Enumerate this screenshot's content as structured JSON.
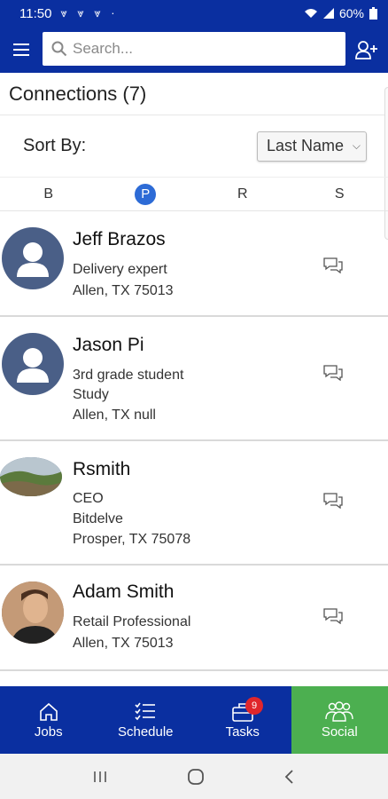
{
  "status_bar": {
    "time": "11:50",
    "notification_icons": "⩔ ⩔ ⩔ ·",
    "battery": "60%"
  },
  "app_bar": {
    "search_placeholder": "Search..."
  },
  "header": {
    "title": "Connections (7)"
  },
  "sort": {
    "label": "Sort By:",
    "selected": "Last Name"
  },
  "letter_index": [
    "B",
    "P",
    "R",
    "S"
  ],
  "active_letter": "P",
  "connections": [
    {
      "name": "Jeff Brazos",
      "line1": "Delivery expert",
      "line2": "Allen, TX 75013",
      "line3": ""
    },
    {
      "name": "Jason Pi",
      "line1": "3rd grade student",
      "line2": "Study",
      "line3": "Allen, TX null"
    },
    {
      "name": "Rsmith",
      "line1": "CEO",
      "line2": "Bitdelve",
      "line3": "Prosper, TX 75078"
    },
    {
      "name": "Adam Smith",
      "line1": "Retail Professional",
      "line2": "Allen, TX 75013",
      "line3": ""
    }
  ],
  "tabs": [
    {
      "label": "Jobs",
      "icon": "home-icon"
    },
    {
      "label": "Schedule",
      "icon": "checklist-icon"
    },
    {
      "label": "Tasks",
      "icon": "briefcase-icon",
      "badge": "9"
    },
    {
      "label": "Social",
      "icon": "people-icon"
    }
  ],
  "colors": {
    "primary": "#0a2fa0",
    "active_tab": "#4caf50",
    "badge": "#e0262c",
    "avatar_bg": "#4a5f87"
  }
}
